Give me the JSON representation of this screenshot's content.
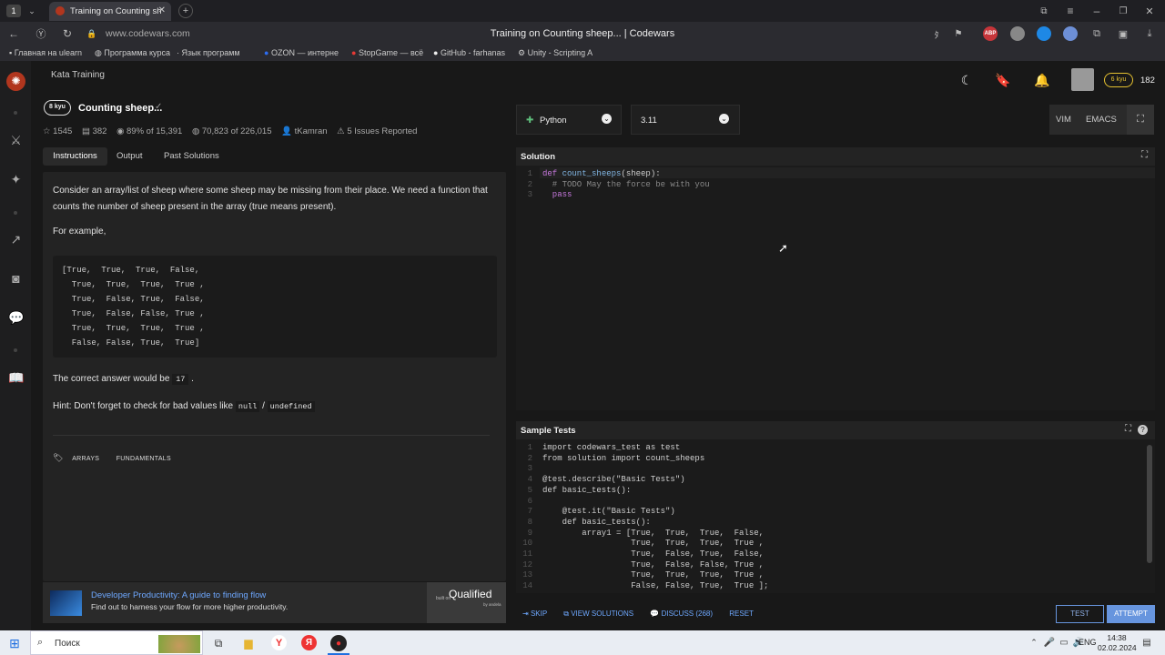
{
  "browser": {
    "tab_count": "1",
    "tab_title": "Training on Counting sh",
    "window_title": "Training on Counting sheep... | Codewars",
    "url": "www.codewars.com",
    "bookmarks": [
      "Главная на ulearn",
      "Программа курса",
      "Язык программ",
      "OZON — интерне",
      "StopGame — всё",
      "GitHub - farhanas",
      "Unity - Scripting A"
    ],
    "ext_abp": "ABP"
  },
  "app": {
    "section": "Kata Training",
    "rank": "8 kyu",
    "kata_title": "Counting sheep...",
    "stats": {
      "stars": "1545",
      "collections": "382",
      "satisfaction": "89% of 15,391",
      "completed": "70,823 of 226,015",
      "author": "tKamran",
      "issues": "5 Issues Reported"
    },
    "tabs": [
      "Instructions",
      "Output",
      "Past Solutions"
    ],
    "user_rank": "6 kyu",
    "honor": "182",
    "description_1": "Consider an array/list of sheep where some sheep may be missing from their place. We need a function that counts the number of sheep present in the array (true means present).",
    "for_example": "For example,",
    "example_lines": [
      "[True,  True,  True,  False,",
      "  True,  True,  True,  True ,",
      "  True,  False, True,  False,",
      "  True,  False, False, True ,",
      "  True,  True,  True,  True ,",
      "  False, False, True,  True]"
    ],
    "answer_text": "The correct answer would be",
    "answer_value": "17",
    "hint_text": "Hint: Don't forget to check for bad values like",
    "hint_null": "null",
    "hint_sep": "/",
    "hint_undefined": "undefined",
    "tags": [
      "ARRAYS",
      "FUNDAMENTALS"
    ],
    "ad_title": "Developer Productivity: A guide to finding flow",
    "ad_text": "Find out to harness your flow for more higher productivity.",
    "ad_brand": "Qualified",
    "ad_brand_small": "by andela",
    "ad_built": "built on"
  },
  "editor": {
    "language": "Python",
    "version": "3.11",
    "modes": [
      "VIM",
      "EMACS"
    ],
    "solution_label": "Solution",
    "solution_lines": [
      [
        "def ",
        "count_sheeps",
        "(sheep):"
      ],
      [
        "  # TODO May the force be with you"
      ],
      [
        "  pass"
      ]
    ],
    "tests_label": "Sample Tests",
    "tests_lines": [
      "import codewars_test as test",
      "from solution import count_sheeps",
      "",
      "@test.describe(\"Basic Tests\")",
      "def basic_tests():",
      "",
      "    @test.it(\"Basic Tests\")",
      "    def basic_tests():",
      "        array1 = [True,  True,  True,  False,",
      "                  True,  True,  True,  True ,",
      "                  True,  False, True,  False,",
      "                  True,  False, False, True ,",
      "                  True,  True,  True,  True ,",
      "                  False, False, True,  True ];"
    ],
    "actions": [
      "SKIP",
      "VIEW SOLUTIONS",
      "DISCUSS (268)",
      "RESET"
    ],
    "test_btn": "TEST",
    "attempt_btn": "ATTEMPT"
  },
  "taskbar": {
    "search": "Поиск",
    "lang": "ENG",
    "time": "14:38",
    "date": "02.02.2024"
  },
  "colors": {
    "accent": "#b1361e",
    "attempt": "#6795de",
    "rank_yellow": "#e6c230"
  }
}
